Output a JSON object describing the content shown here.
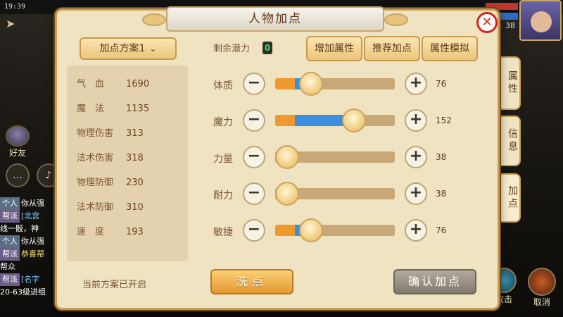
{
  "hud": {
    "time": "19:39",
    "friends_label": "好友",
    "level": "38",
    "attack_label": "攻击",
    "cancel_label": "取消"
  },
  "chat": [
    {
      "tag": "个人",
      "text": "你从强"
    },
    {
      "tag": "帮派",
      "text": "[北宫"
    },
    {
      "tag": "",
      "text": "线一骰，神"
    },
    {
      "tag": "个人",
      "text": "你从强"
    },
    {
      "tag": "帮派",
      "text": "恭喜帮"
    },
    {
      "tag": "",
      "text": "帮众"
    },
    {
      "tag": "帮派",
      "text": "[名字"
    },
    {
      "tag": "",
      "text": "20-63级进组"
    }
  ],
  "dialog": {
    "title": "人物加点",
    "close_icon": "close-icon"
  },
  "left_panel": {
    "plan_dropdown": "加点方案1",
    "stats": [
      {
        "label": "气　血",
        "value": "1690"
      },
      {
        "label": "魔　法",
        "value": "1135"
      },
      {
        "label": "物理伤害",
        "value": "313"
      },
      {
        "label": "法术伤害",
        "value": "318"
      },
      {
        "label": "物理防御",
        "value": "230"
      },
      {
        "label": "法术防御",
        "value": "310"
      },
      {
        "label": "速　度",
        "value": "193"
      }
    ],
    "plan_status": "当前方案已开启"
  },
  "right_panel": {
    "potential_label": "剩余潜力",
    "potential_value": "0",
    "buttons": {
      "add_attr": "增加属性",
      "recommend": "推荐加点",
      "simulate": "属性模拟"
    },
    "attributes": [
      {
        "label": "体质",
        "value": "76",
        "fill_fraction": 0.3
      },
      {
        "label": "魔力",
        "value": "152",
        "fill_fraction": 0.66
      },
      {
        "label": "力量",
        "value": "38",
        "fill_fraction": 0.1
      },
      {
        "label": "耐力",
        "value": "38",
        "fill_fraction": 0.1
      },
      {
        "label": "敏捷",
        "value": "76",
        "fill_fraction": 0.3
      }
    ],
    "wash_button": "洗点",
    "confirm_button": "确认加点"
  },
  "side_tabs": [
    {
      "label": "属性",
      "active": false
    },
    {
      "label": "信息",
      "active": false
    },
    {
      "label": "加点",
      "active": true
    }
  ],
  "colors": {
    "panel_bg": "#efe3c2",
    "border_gold": "#c99b52",
    "slider_orange": "#ee9a2f",
    "slider_blue": "#3b8ee0",
    "potential_green": "#46d84a",
    "close_red": "#c92a1b"
  }
}
